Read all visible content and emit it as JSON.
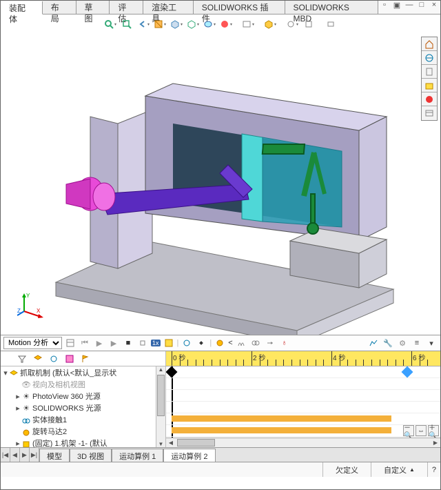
{
  "ribbon": {
    "tabs": [
      "装配体",
      "布局",
      "草图",
      "评估",
      "渲染工具",
      "SOLIDWORKS 插件",
      "SOLIDWORKS MBD"
    ],
    "active": 0
  },
  "side_tools": [
    "home-icon",
    "globe-icon",
    "scale-icon",
    "fit-icon",
    "palette-icon",
    "list-icon"
  ],
  "triad": {
    "x": "X",
    "y": "Y",
    "z": "Z"
  },
  "motion": {
    "mode": "Motion 分析",
    "speed": "1x"
  },
  "timeline": {
    "unit": "秒",
    "majors": [
      0,
      2,
      4,
      6
    ],
    "rows": 6,
    "bars": [
      {
        "row": 4,
        "start": 0,
        "end": 5.5
      },
      {
        "row": 5,
        "start": 0,
        "end": 5.5
      }
    ],
    "keys": [
      {
        "row": 0,
        "t": 0,
        "color": "#000"
      },
      {
        "row": 0,
        "t": 5.9,
        "color": "#3aa0ff"
      }
    ]
  },
  "tree": {
    "root": "抓取机制  (默认<默认_显示状",
    "items": [
      {
        "icon": "eye",
        "label": "视向及相机视图",
        "dim": true
      },
      {
        "icon": "sun",
        "label": "PhotoView 360 光源",
        "exp": "▸"
      },
      {
        "icon": "sun",
        "label": "SOLIDWORKS 光源",
        "exp": "▸"
      },
      {
        "icon": "link",
        "label": "实体接触1"
      },
      {
        "icon": "motor",
        "label": "旋转马达2"
      },
      {
        "icon": "part",
        "label": "(固定) 1.机架 -1- (默认",
        "exp": "▸"
      }
    ]
  },
  "bottom_tabs": {
    "items": [
      "模型",
      "3D 视图",
      "运动算例 1",
      "运动算例 2"
    ],
    "active": 3
  },
  "status": {
    "center": "欠定义",
    "right": "自定义"
  }
}
